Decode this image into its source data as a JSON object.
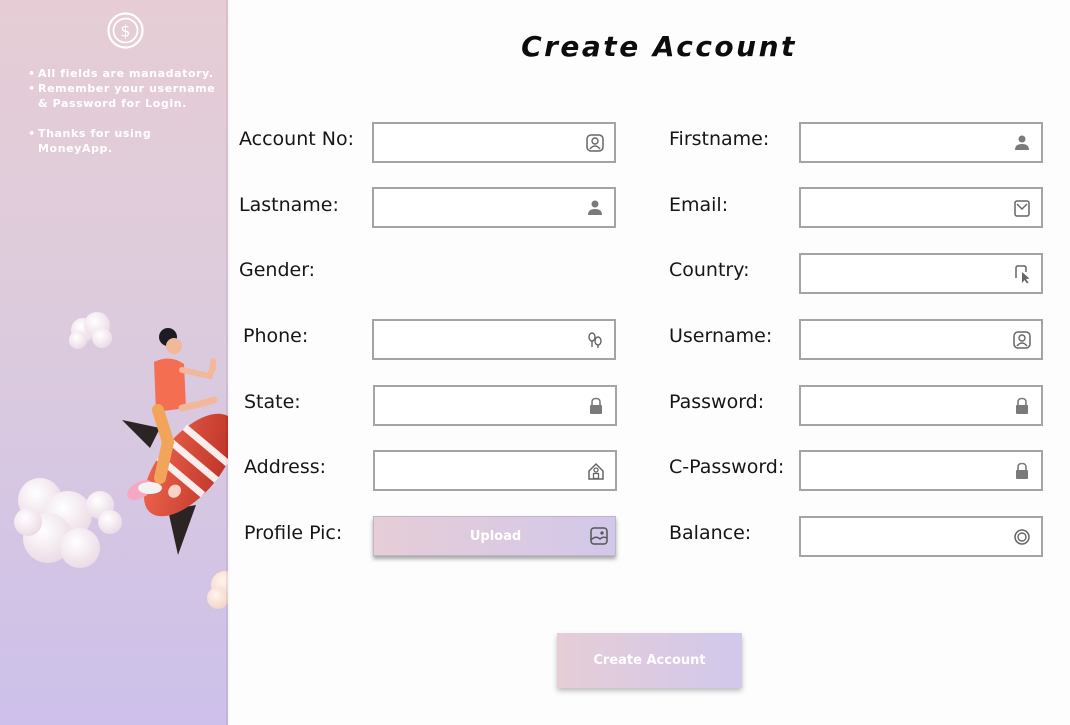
{
  "sidebar": {
    "logo_icon": "dollar-coin-icon",
    "notes": [
      "All fields are manadatory.",
      "Remember your username & Password for Login.",
      "Thanks for using MoneyApp."
    ]
  },
  "form": {
    "title": "Create Account",
    "fields": {
      "account_no": {
        "label": "Account No:",
        "icon": "user-badge-icon",
        "value": ""
      },
      "firstname": {
        "label": "Firstname:",
        "icon": "person-icon",
        "value": ""
      },
      "lastname": {
        "label": "Lastname:",
        "icon": "person-icon",
        "value": ""
      },
      "email": {
        "label": "Email:",
        "icon": "envelope-icon",
        "value": ""
      },
      "gender": {
        "label": "Gender:"
      },
      "country": {
        "label": "Country:",
        "icon": "cursor-click-icon",
        "value": ""
      },
      "phone": {
        "label": "Phone:",
        "icon": "phone-icon",
        "value": ""
      },
      "username": {
        "label": "Username:",
        "icon": "user-badge-icon",
        "value": ""
      },
      "state": {
        "label": "State:",
        "icon": "lock-icon",
        "value": ""
      },
      "password": {
        "label": "Password:",
        "icon": "lock-icon",
        "value": ""
      },
      "address": {
        "label": "Address:",
        "icon": "home-icon",
        "value": ""
      },
      "c_password": {
        "label": "C-Password:",
        "icon": "lock-icon",
        "value": ""
      },
      "profile_pic": {
        "label": "Profile Pic:",
        "button": "Upload",
        "icon": "image-icon"
      },
      "balance": {
        "label": "Balance:",
        "icon": "coin-icon",
        "value": ""
      }
    },
    "submit_label": "Create Account"
  },
  "colors": {
    "sidebar_top": "#e6cdd5",
    "sidebar_bottom": "#cdc0ea",
    "field_border": "#a4a4a4",
    "button_gradient_start": "#e6cdd6",
    "button_gradient_end": "#d2c8ea"
  }
}
